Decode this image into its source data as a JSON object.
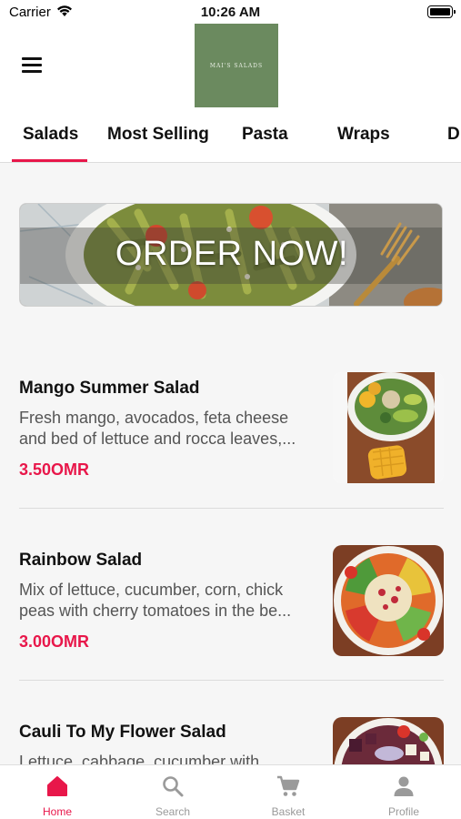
{
  "status_bar": {
    "carrier": "Carrier",
    "time": "10:26 AM"
  },
  "header": {
    "logo_text": "MAI'S SALADS"
  },
  "tabs": [
    {
      "label": "Salads",
      "active": true
    },
    {
      "label": "Most Selling"
    },
    {
      "label": "Pasta"
    },
    {
      "label": "Wraps"
    },
    {
      "label": "Di"
    }
  ],
  "banner": {
    "text": "ORDER NOW!"
  },
  "items": [
    {
      "name": "Mango Summer Salad",
      "desc_line1": "Fresh mango, avocados, feta cheese",
      "desc_line2": "and bed of lettuce and rocca leaves,...",
      "price": "3.50OMR"
    },
    {
      "name": "Rainbow Salad",
      "desc_line1": "Mix of lettuce, cucumber, corn, chick",
      "desc_line2": "peas with cherry tomatoes in the be...",
      "price": "3.00OMR"
    },
    {
      "name": "Cauli To My Flower Salad",
      "desc_line1": "Lettuce, cabbage, cucumber with",
      "desc_line2": "",
      "price": ""
    }
  ],
  "bottom_nav": [
    {
      "label": "Home",
      "icon": "home-icon",
      "active": true
    },
    {
      "label": "Search",
      "icon": "search-icon"
    },
    {
      "label": "Basket",
      "icon": "cart-icon"
    },
    {
      "label": "Profile",
      "icon": "person-icon"
    }
  ],
  "colors": {
    "accent": "#e8174a",
    "logo_bg": "#6b8a5f",
    "muted": "#9a9a9a"
  }
}
